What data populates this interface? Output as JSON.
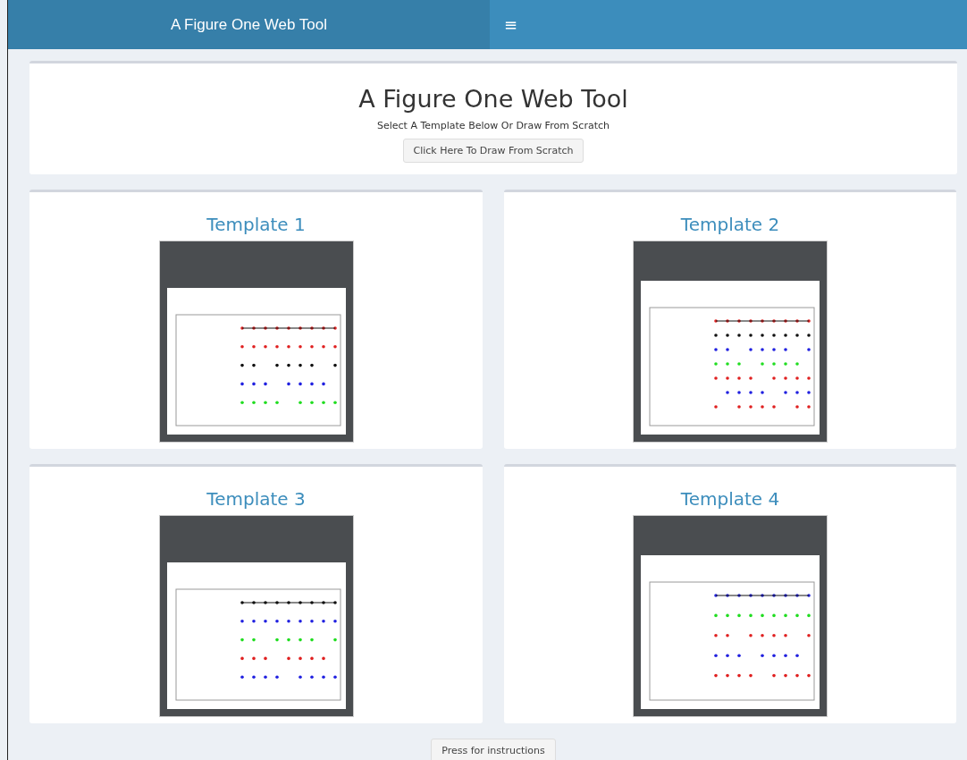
{
  "header": {
    "brand": "A Figure One Web Tool",
    "menu_toggle": "≡"
  },
  "intro": {
    "title": "A Figure One Web Tool",
    "subtitle": "Select A Template Below Or Draw From Scratch",
    "button": "Click Here To Draw From Scratch"
  },
  "templates": [
    {
      "title": "Template 1"
    },
    {
      "title": "Template 2"
    },
    {
      "title": "Template 3"
    },
    {
      "title": "Template 4"
    }
  ],
  "footer_button": "Press for instructions"
}
